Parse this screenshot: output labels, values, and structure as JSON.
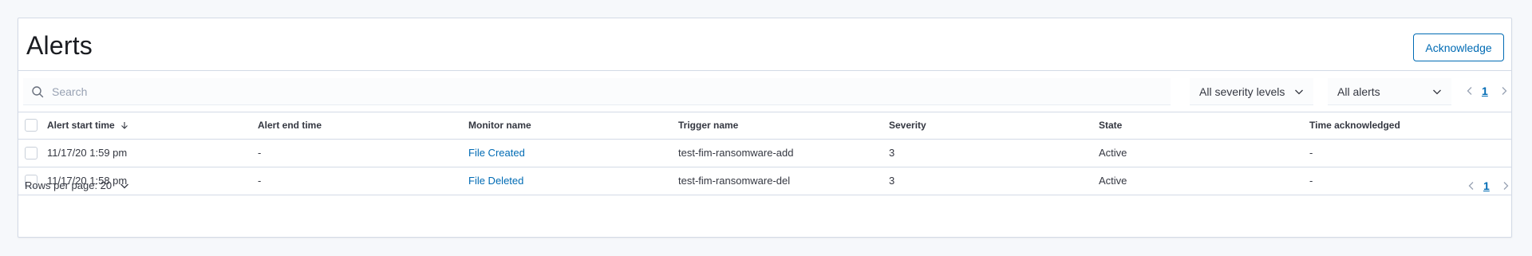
{
  "header": {
    "title": "Alerts",
    "acknowledge_label": "Acknowledge"
  },
  "toolbar": {
    "search_placeholder": "Search",
    "severity_select": "All severity levels",
    "alerts_select": "All alerts",
    "current_page": "1"
  },
  "table": {
    "columns": [
      "Alert start time",
      "Alert end time",
      "Monitor name",
      "Trigger name",
      "Severity",
      "State",
      "Time acknowledged"
    ],
    "rows": [
      {
        "start": "11/17/20 1:59 pm",
        "end": "-",
        "monitor": "File Created",
        "trigger": "test-fim-ransomware-add",
        "severity": "3",
        "state": "Active",
        "ack": "-"
      },
      {
        "start": "11/17/20 1:58 pm",
        "end": "-",
        "monitor": "File Deleted",
        "trigger": "test-fim-ransomware-del",
        "severity": "3",
        "state": "Active",
        "ack": "-"
      }
    ]
  },
  "footer": {
    "rows_per_page": "Rows per page: 20",
    "current_page": "1"
  },
  "colors": {
    "accent": "#006bb4",
    "border": "#d3dae6",
    "background": "#f6f8fb"
  },
  "icons": [
    "search-icon",
    "chevron-down-icon",
    "chevron-left-icon",
    "chevron-right-icon",
    "sort-down-icon"
  ]
}
